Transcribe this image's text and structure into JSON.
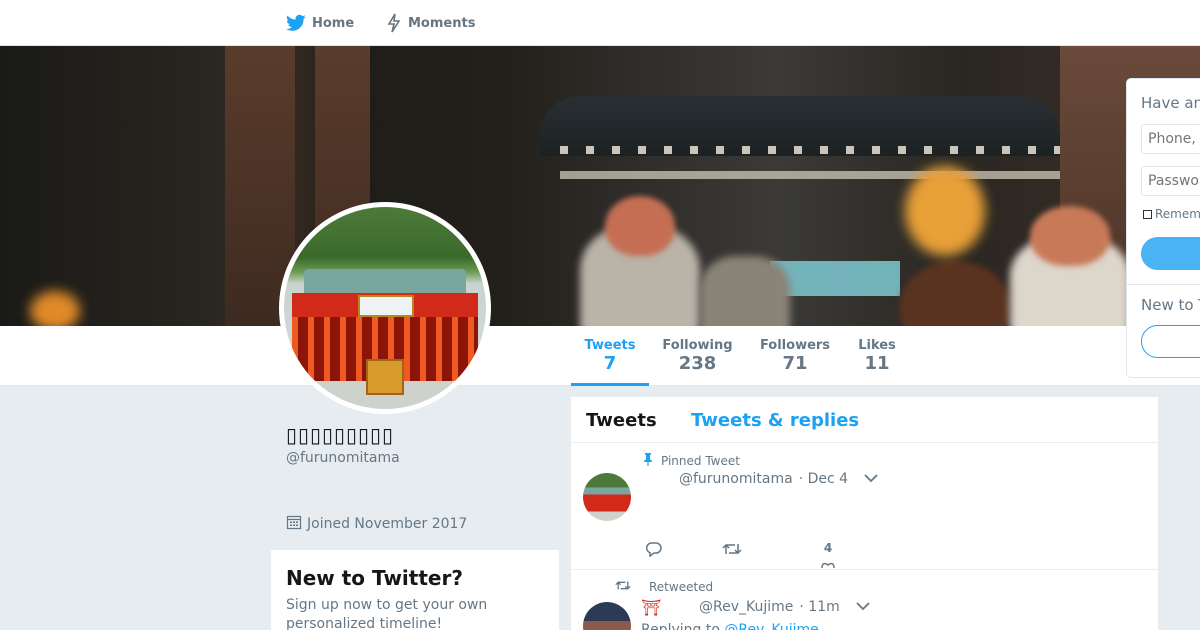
{
  "nav": {
    "home_label": "Home",
    "moments_label": "Moments",
    "icons": {
      "home": "twitter-bird-icon",
      "moments": "lightning-icon"
    }
  },
  "profile": {
    "display_name": "▯▯▯▯▯▯▯▯▯",
    "handle": "@furunomitama",
    "joined": "Joined November 2017"
  },
  "stats": [
    {
      "label": "Tweets",
      "value": "7",
      "active": true
    },
    {
      "label": "Following",
      "value": "238",
      "active": false
    },
    {
      "label": "Followers",
      "value": "71",
      "active": false
    },
    {
      "label": "Likes",
      "value": "11",
      "active": false
    }
  ],
  "signup_card": {
    "title": "New to Twitter?",
    "text": "Sign up now to get your own personalized timeline!"
  },
  "timeline": {
    "tabs": [
      {
        "label": "Tweets",
        "active": true
      },
      {
        "label": "Tweets & replies",
        "active": false
      }
    ],
    "tweets": [
      {
        "context": "Pinned Tweet",
        "handle": "@furunomitama",
        "time": "· Dec 4",
        "like_count": "4"
      },
      {
        "context": "Retweeted",
        "badge": "⛩",
        "handle": "@Rev_Kujime",
        "time": "· 11m",
        "replying_prefix": "Replying to",
        "replying_to": "@Rev_Kujime"
      }
    ]
  },
  "login": {
    "title": "Have an",
    "phone_placeholder": "Phone, e",
    "password_placeholder": "Passwor",
    "remember_label": "Remem",
    "new_to": "New to T"
  },
  "colors": {
    "accent": "#1da1f2",
    "background": "#e6ecf0",
    "text_secondary": "#657786"
  }
}
